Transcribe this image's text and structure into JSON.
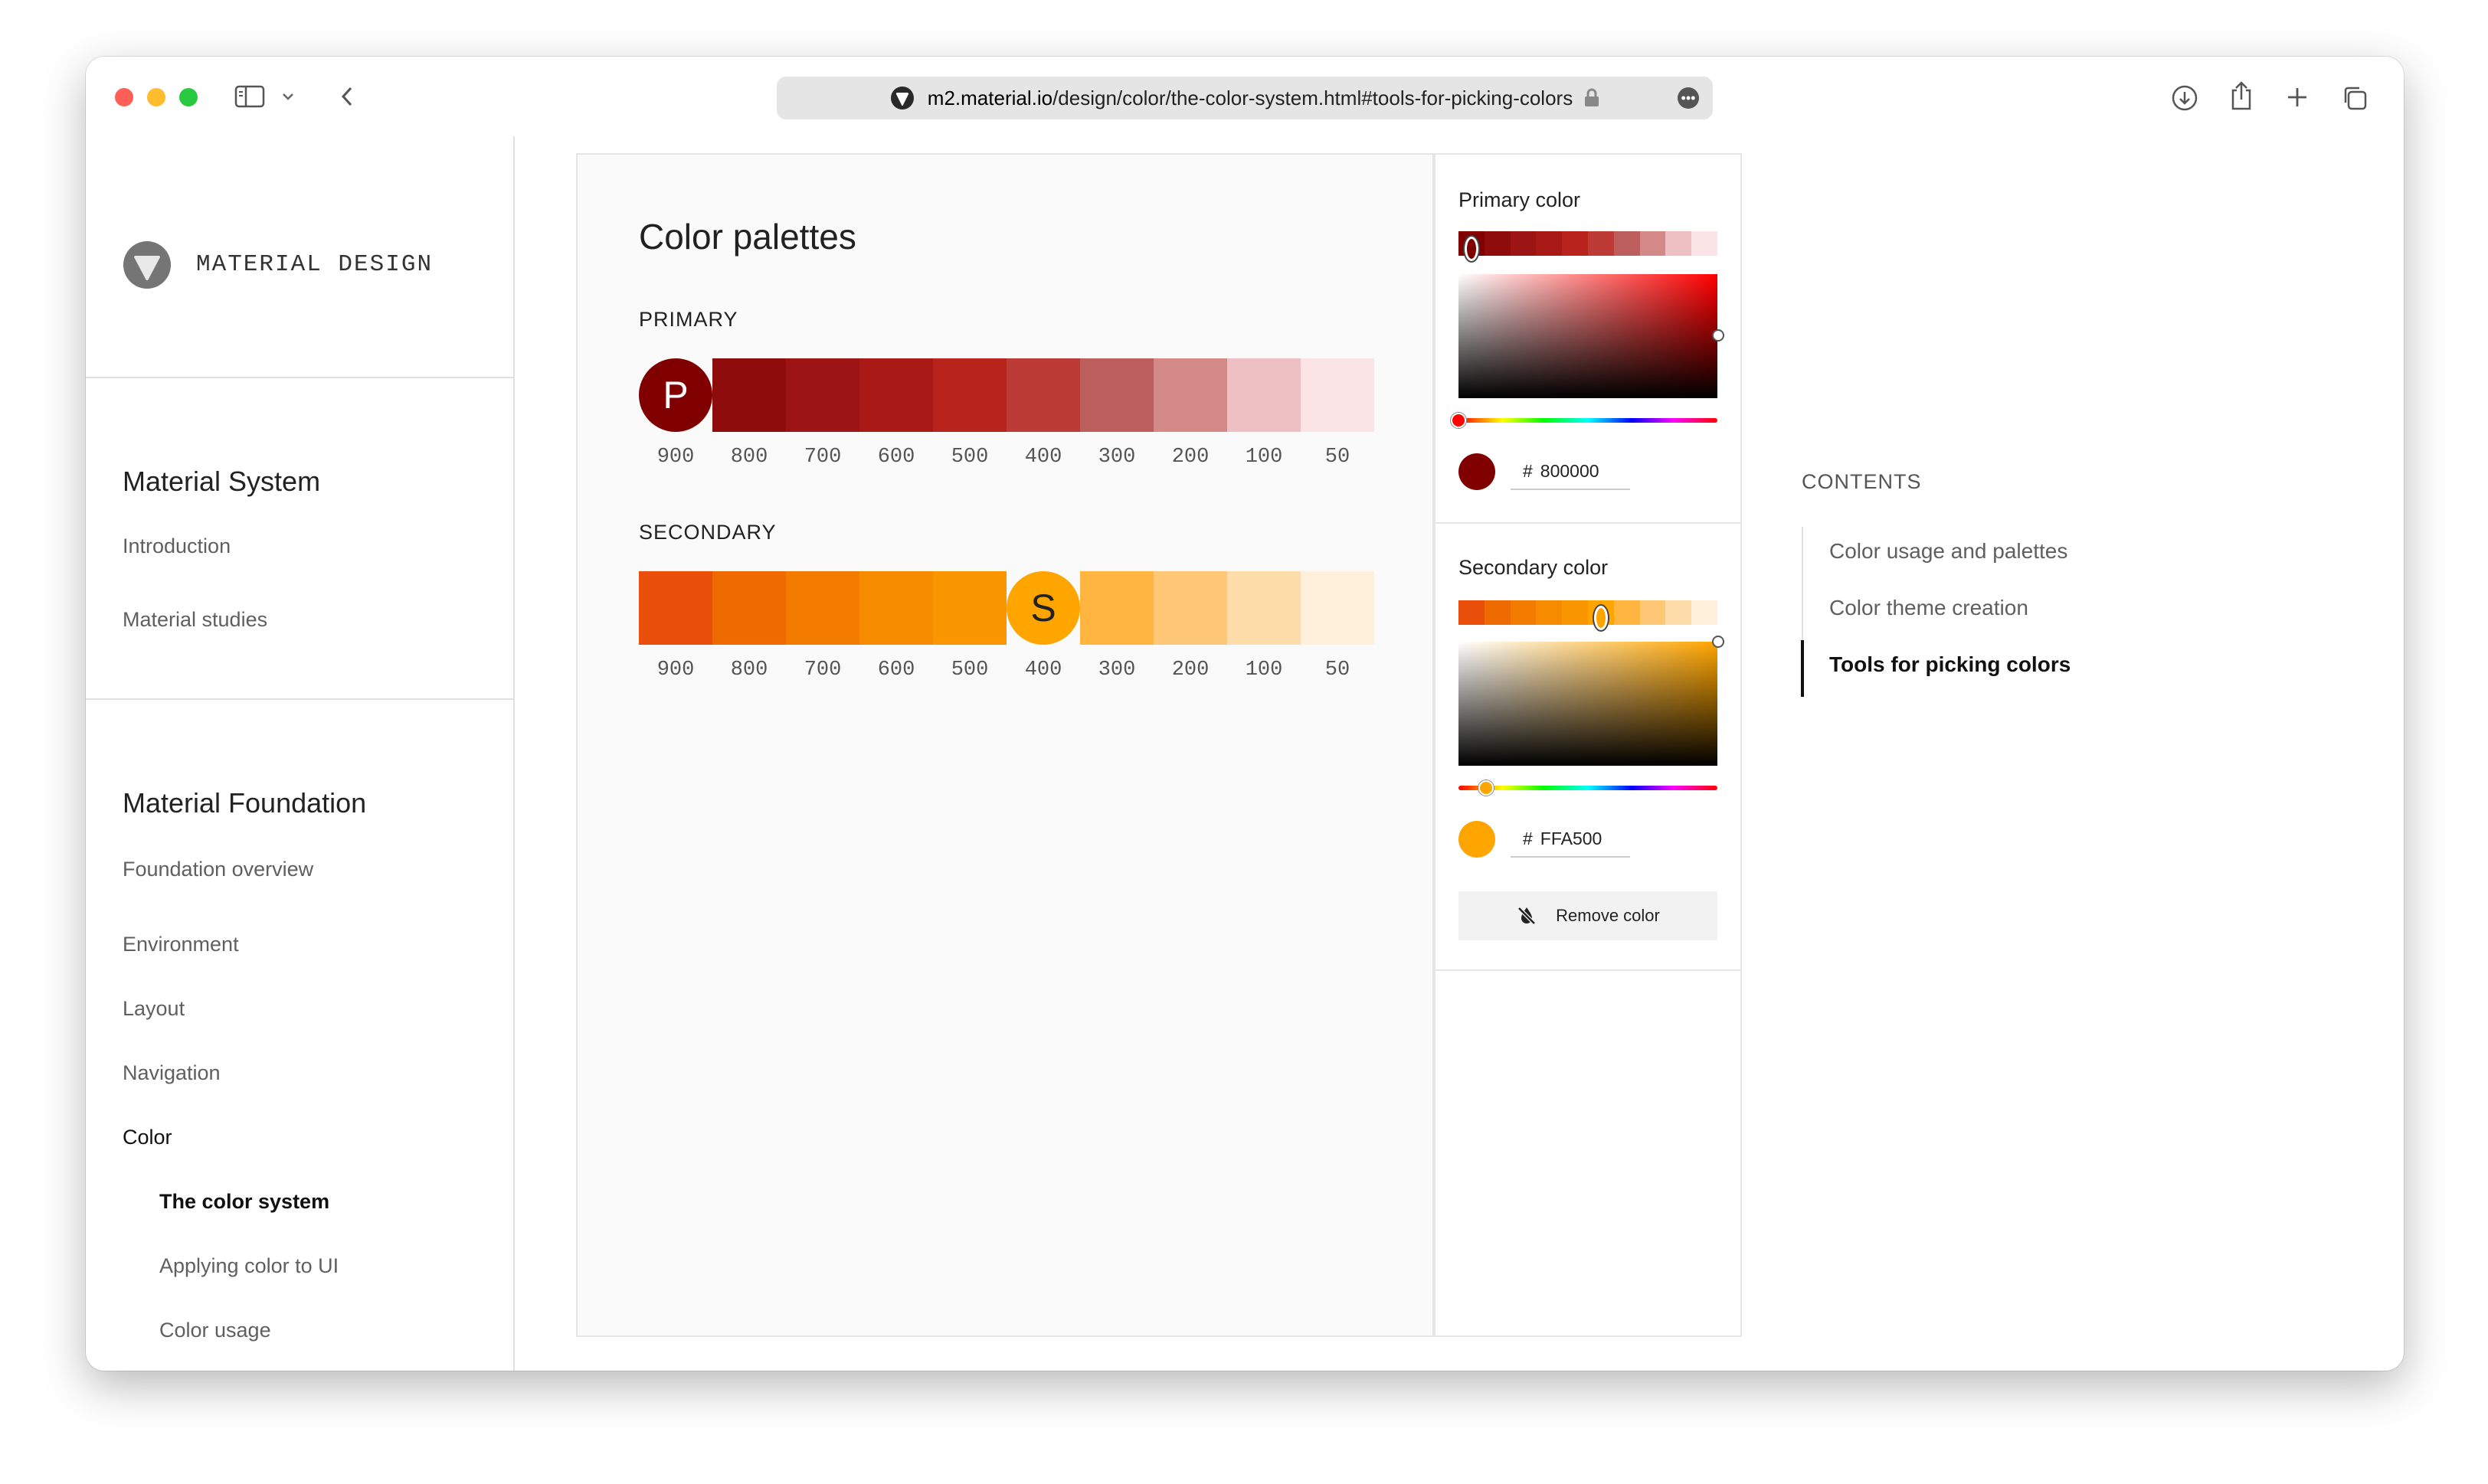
{
  "browser": {
    "url_domain": "m2.material.io",
    "url_path": "/design/color/the-color-system.html#tools-for-picking-colors"
  },
  "sidebar": {
    "brand": "MATERIAL DESIGN",
    "sections": [
      {
        "title": "Material System",
        "items": [
          "Introduction",
          "Material studies"
        ]
      },
      {
        "title": "Material Foundation",
        "items": [
          "Foundation overview",
          "Environment",
          "Layout",
          "Navigation",
          "Color"
        ]
      }
    ],
    "color_sub_items": [
      "The color system",
      "Applying color to UI",
      "Color usage"
    ]
  },
  "palettes": {
    "title": "Color palettes",
    "primary": {
      "label": "PRIMARY",
      "badge": "P",
      "badge_text_color": "#ffffff",
      "badge_index": 0,
      "colors": [
        "#800000",
        "#8e0c0c",
        "#9c1414",
        "#a91a16",
        "#b8241b",
        "#bd3b37",
        "#bc5e5b",
        "#d38985",
        "#efc0c3",
        "#fbe4e6"
      ]
    },
    "secondary": {
      "label": "SECONDARY",
      "badge": "S",
      "badge_text_color": "#222222",
      "badge_index": 5,
      "colors": [
        "#e94f0a",
        "#ef6a00",
        "#f37c00",
        "#f78b00",
        "#fa9600",
        "#ffa500",
        "#ffb53f",
        "#ffc877",
        "#ffddaa",
        "#fff0db"
      ]
    },
    "shades": [
      "900",
      "800",
      "700",
      "600",
      "500",
      "400",
      "300",
      "200",
      "100",
      "50"
    ]
  },
  "picker": {
    "primary": {
      "title": "Primary color",
      "hex_prefix": "#",
      "hex": "800000",
      "color": "#800000",
      "strip": [
        "#800000",
        "#8e0c0c",
        "#9c1414",
        "#a91a16",
        "#b8241b",
        "#bd3b37",
        "#bc5e5b",
        "#d38985",
        "#efc0c3",
        "#fbe4e6"
      ],
      "hue_color": "#ff0000",
      "selected_shade_index": 0
    },
    "secondary": {
      "title": "Secondary color",
      "hex_prefix": "#",
      "hex": "FFA500",
      "color": "#ffa500",
      "strip": [
        "#e94f0a",
        "#ef6a00",
        "#f37c00",
        "#f78b00",
        "#fa9600",
        "#ffa500",
        "#ffb53f",
        "#ffc877",
        "#ffddaa",
        "#fff0db"
      ],
      "hue_color": "#ffa500",
      "selected_shade_index": 5
    },
    "remove_label": "Remove color"
  },
  "contents": {
    "title": "CONTENTS",
    "items": [
      "Color usage and palettes",
      "Color theme creation",
      "Tools for picking colors"
    ],
    "active_index": 2
  }
}
